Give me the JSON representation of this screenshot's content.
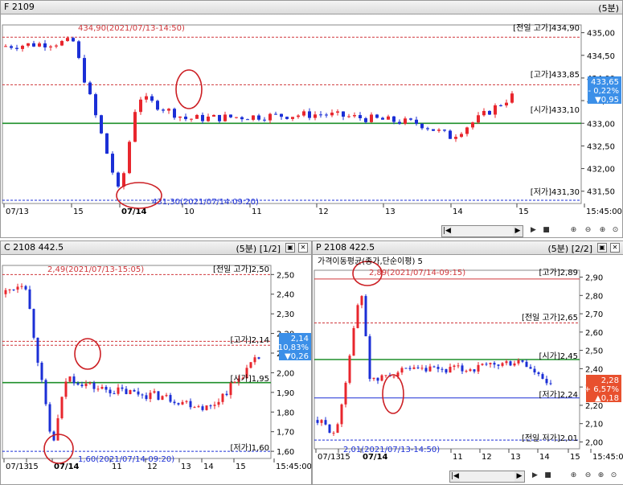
{
  "top": {
    "title": "F 2109",
    "interval": "(5분)",
    "y_ticks": [
      "435,00",
      "434,50",
      "434,00",
      "433,50",
      "433,00",
      "432,50",
      "432,00",
      "431,50"
    ],
    "x_ticks": [
      "07/13",
      "15",
      "07/14",
      "10",
      "11",
      "12",
      "13",
      "14",
      "15",
      "15:45:00"
    ],
    "annotations": {
      "high_mark": "434,90(2021/07/13-14:50)",
      "low_mark": "431,30(2021/07/14-09:20)",
      "prev_high": "[전일 고가]434,90",
      "day_high": "[고가]433,85",
      "open": "[시가]433,10",
      "prev_low": "[전일 저가]",
      "day_low": "[저가]431,30"
    },
    "price_badge": {
      "price": "433,65",
      "change_pct": "- 0,22%",
      "change": "▼0,95"
    }
  },
  "left": {
    "title": "C 2108 442.5",
    "interval": "(5분)",
    "page": "[1/2]",
    "y_ticks": [
      "2,50",
      "2,40",
      "2,30",
      "2,20",
      "2,10",
      "2,00",
      "1,90",
      "1,80",
      "1,70",
      "1,60"
    ],
    "x_ticks": [
      "07/13",
      "15",
      "07/14",
      "11",
      "12",
      "13",
      "14",
      "15",
      "15:45:00"
    ],
    "annotations": {
      "high_mark": "2,49(2021/07/13-15:05)",
      "low_mark": "1,60(2021/07/14-09:20)",
      "prev_high": "[전일 고가]2,50",
      "day_high": "[고가]2,14",
      "prev_low": "[전일 저가]2,16",
      "open": "[시가]1,95",
      "day_low": "[저가]1,60"
    },
    "price_badge": {
      "price": "2,14",
      "change_pct": "- 10,83%",
      "change": "▼0,26"
    }
  },
  "right": {
    "title": "P 2108 422.5",
    "interval": "(5분)",
    "page": "[2/2]",
    "indicator": "가격이동평균(종가,단순이평) 5",
    "y_ticks": [
      "2,90",
      "2,80",
      "2,70",
      "2,60",
      "2,50",
      "2,40",
      "2,30",
      "2,20",
      "2,10",
      "2,00"
    ],
    "x_ticks": [
      "07/13",
      "15",
      "07/14",
      "11",
      "12",
      "13",
      "14",
      "15",
      "15:45:00"
    ],
    "annotations": {
      "high_mark": "2,89(2021/07/14-09:15)",
      "low_mark": "2,01(2021/07/13-14:50)",
      "day_high": "[고가]2,89",
      "prev_high": "[전일 고가]2,65",
      "open": "[시가]2,45",
      "day_low": "[저가]2,24",
      "prev_low": "[전일 저가]2,01"
    },
    "price_badge": {
      "price": "2,28",
      "change_pct": "+ 6,57%",
      "change": "▲0,18"
    }
  },
  "colors": {
    "up": "#e8262d",
    "down": "#1b2fd6",
    "prev_line": "#d0373b",
    "open_line": "#1e8f2a",
    "badge_down": "#3b8fe8",
    "badge_up": "#e8502e",
    "circle": "#cc1f24"
  },
  "chart_data": [
    {
      "type": "line",
      "title": "F 2109",
      "ylim": [
        431.3,
        435.1
      ],
      "x": [
        "07/13",
        "15",
        "07/14",
        "10",
        "11",
        "12",
        "13",
        "14",
        "15"
      ],
      "series": [
        {
          "values": [
            434.7,
            434.8,
            431.4,
            433.6,
            433.1,
            433.2,
            433.0,
            432.7,
            433.65
          ]
        }
      ]
    },
    {
      "type": "line",
      "title": "C 2108 442.5",
      "ylim": [
        1.58,
        2.53
      ],
      "x": [
        "07/13",
        "15",
        "07/14",
        "11",
        "12",
        "13",
        "14",
        "15"
      ],
      "series": [
        {
          "values": [
            2.4,
            2.47,
            1.62,
            1.98,
            1.92,
            1.88,
            1.82,
            2.14
          ]
        }
      ]
    },
    {
      "type": "line",
      "title": "P 2108 422.5",
      "ylim": [
        1.98,
        2.92
      ],
      "x": [
        "07/13",
        "15",
        "07/14",
        "11",
        "12",
        "13",
        "14",
        "15"
      ],
      "series": [
        {
          "values": [
            2.12,
            2.05,
            2.85,
            2.32,
            2.38,
            2.4,
            2.44,
            2.28
          ]
        }
      ]
    }
  ]
}
